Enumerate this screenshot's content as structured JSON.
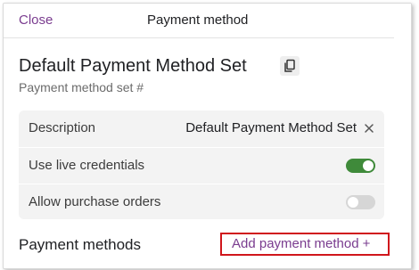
{
  "header": {
    "close_label": "Close",
    "title": "Payment method"
  },
  "set": {
    "name": "Default Payment Method Set",
    "subtitle": "Payment method set #"
  },
  "settings": {
    "description_label": "Description",
    "description_value": "Default Payment Method Set",
    "live_credentials_label": "Use live credentials",
    "live_credentials_on": true,
    "purchase_orders_label": "Allow purchase orders",
    "purchase_orders_on": false
  },
  "payment_methods": {
    "title": "Payment methods",
    "add_label": "Add payment method",
    "add_plus": "+"
  },
  "colors": {
    "accent": "#7a3c8f",
    "toggle_on": "#3f8a3a",
    "toggle_off": "#d6d6d6",
    "highlight_border": "#d0161c"
  },
  "icons": {
    "copy": "copy-icon",
    "clear": "close-icon"
  }
}
